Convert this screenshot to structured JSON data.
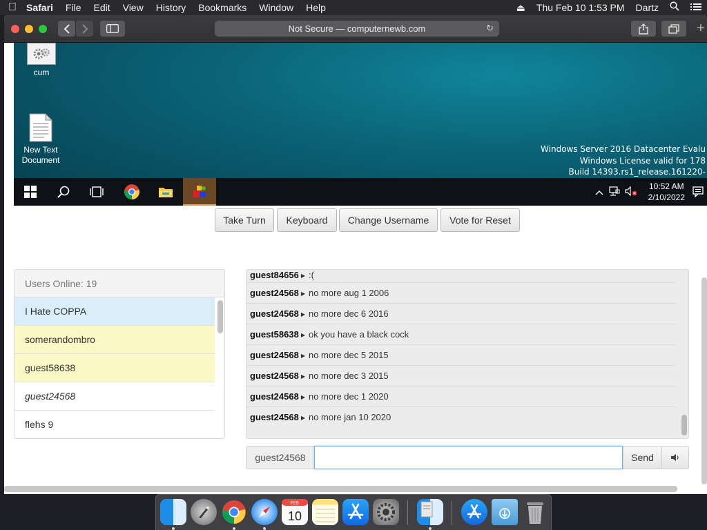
{
  "menubar": {
    "app_name": "Safari",
    "items": [
      "File",
      "Edit",
      "View",
      "History",
      "Bookmarks",
      "Window",
      "Help"
    ],
    "datetime": "Thu Feb 10  1:53 PM",
    "user": "Dartz"
  },
  "browser": {
    "address": "Not Secure — computernewb.com"
  },
  "vm": {
    "desktop_icons": [
      {
        "label": "cum"
      },
      {
        "label": "New Text Document"
      }
    ],
    "watermark": {
      "line1": "Windows Server 2016 Datacenter Evalu",
      "line2": "Windows License valid for 178",
      "line3": "Build 14393.rs1_release.161220-"
    },
    "clock": {
      "time": "10:52 AM",
      "date": "2/10/2022"
    }
  },
  "controls": {
    "take_turn": "Take Turn",
    "keyboard": "Keyboard",
    "change_username": "Change Username",
    "vote_reset": "Vote for Reset"
  },
  "users": {
    "header": "Users Online: 19",
    "list": [
      {
        "name": "I Hate COPPA"
      },
      {
        "name": "somerandombro"
      },
      {
        "name": "guest58638"
      },
      {
        "name": "guest24568"
      },
      {
        "name": "flehs 9"
      }
    ]
  },
  "chat": {
    "messages": [
      {
        "user": "guest84656",
        "text": ":("
      },
      {
        "user": "guest24568",
        "text": "no more aug 1 2006"
      },
      {
        "user": "guest24568",
        "text": "no more dec 6 2016"
      },
      {
        "user": "guest58638",
        "text": "ok you have a black cock"
      },
      {
        "user": "guest24568",
        "text": "no more dec 5 2015"
      },
      {
        "user": "guest24568",
        "text": "no more dec 3 2015"
      },
      {
        "user": "guest24568",
        "text": "no more dec 1 2020"
      },
      {
        "user": "guest24568",
        "text": "no more jan 10 2020"
      }
    ],
    "username": "guest24568",
    "input_value": "",
    "send_label": "Send"
  },
  "colors": {
    "chrome": "#2a2a2c",
    "active_user": "#d9eef8",
    "highlight_user": "#fcf9c6",
    "focus_border": "#6fb0e8"
  }
}
